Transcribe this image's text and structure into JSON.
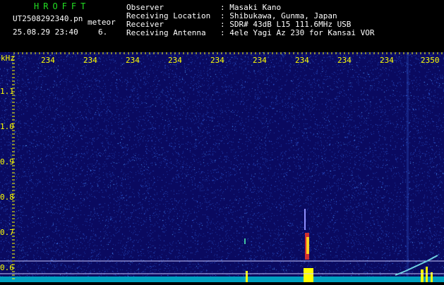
{
  "header": {
    "logo": "HROFFT",
    "file": "UT2508292340.pn",
    "mode": "meteor",
    "datetime": "25.08.29 23:40",
    "count": "6.",
    "labels": [
      "Observer",
      "Receiving Location",
      "Receiver",
      "Receiving Antenna"
    ],
    "values": [
      ": Masaki Kano",
      ": Shibukawa, Gunma, Japan",
      ": SDR# 43dB L15 111.6MHz USB",
      ": 4ele Yagi Az 230 for Kansai VOR"
    ]
  },
  "axis": {
    "y_unit": "kHz",
    "y_ticks": [
      "1.1",
      "1.0",
      "0.9",
      "0.8",
      "0.7",
      "0.6"
    ],
    "x_ticks": [
      "234",
      "234",
      "234",
      "234",
      "234",
      "234",
      "234",
      "234",
      "234",
      "2350"
    ]
  },
  "colors": {
    "background": "#0a0a60",
    "noise": "#2850d8",
    "echo": "#ffff00",
    "grid_label": "#ffff00"
  }
}
